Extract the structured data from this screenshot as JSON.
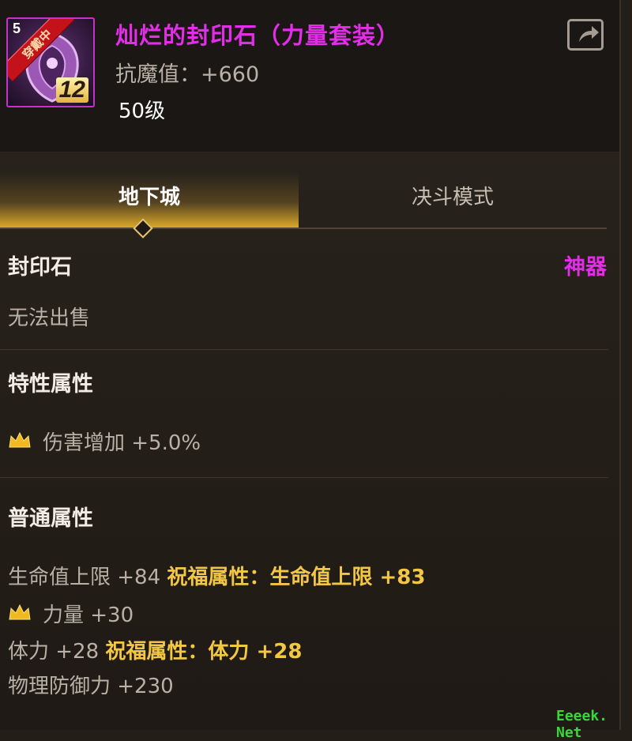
{
  "item": {
    "icon_level_number": "5",
    "equipped_badge": "穿戴中",
    "enhance_level": "12",
    "name": "灿烂的封印石（力量套装）",
    "resist_label": "抗魔值：",
    "resist_value": "+660",
    "level": "50级"
  },
  "tabs": {
    "dungeon": "地下城",
    "duel": "决斗模式"
  },
  "info": {
    "type": "封印石",
    "rarity": "神器",
    "sell_status": "无法出售"
  },
  "special_attributes": {
    "title": "特性属性",
    "items": [
      {
        "text": "伤害增加 +5.0%"
      }
    ]
  },
  "normal_attributes": {
    "title": "普通属性",
    "line1": {
      "stat": "生命值上限 +84",
      "blessing": "祝福属性：生命值上限 +83"
    },
    "line2": {
      "stat": "力量 +30"
    },
    "line3": {
      "stat": "体力 +28",
      "blessing": "祝福属性：体力 +28"
    },
    "line4": {
      "stat": "物理防御力 +230"
    }
  },
  "watermark": "Eeeek. Net",
  "colors": {
    "rarity_magenta": "#e22ee8",
    "gold": "#f2c744",
    "background": "#241e18"
  }
}
